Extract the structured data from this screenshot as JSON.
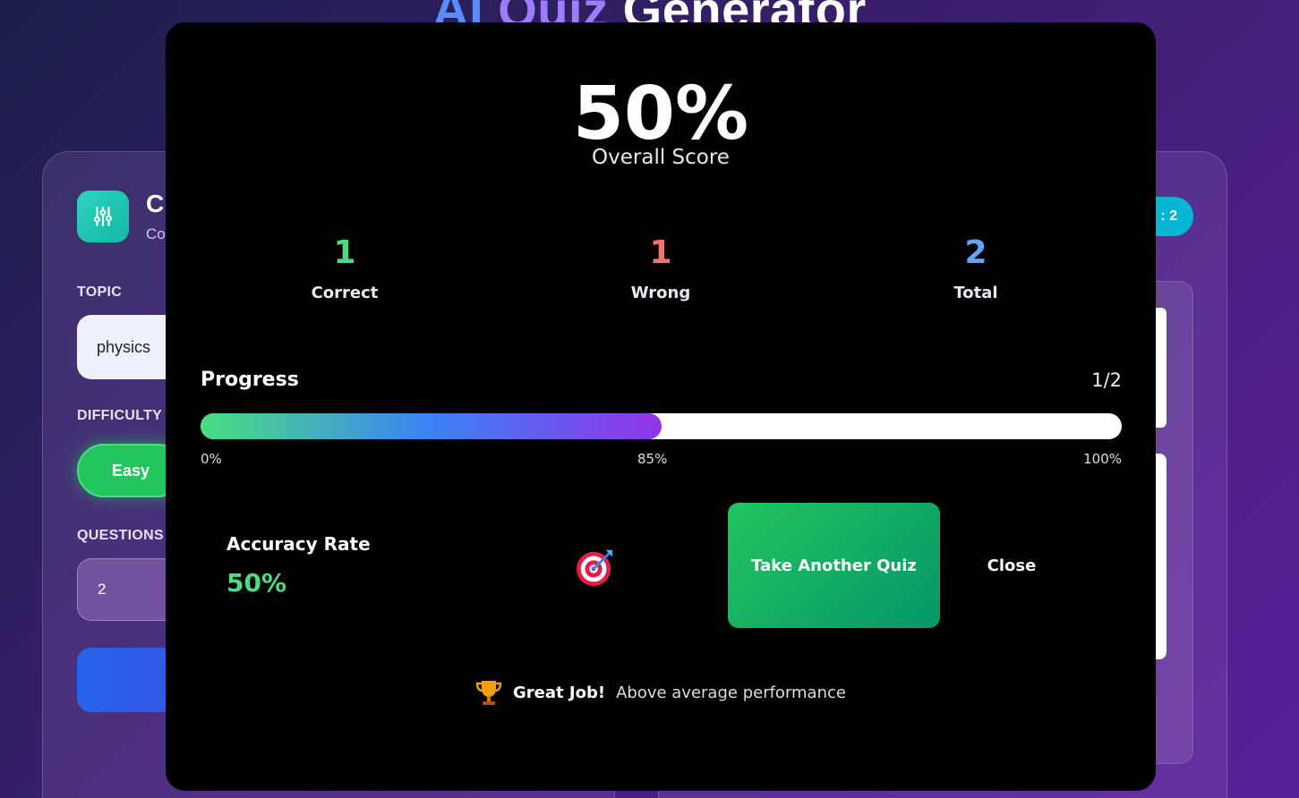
{
  "app": {
    "title_parts": [
      "AI",
      "Quiz",
      "Generator"
    ]
  },
  "config": {
    "title": "Cr",
    "subtitle": "Co",
    "topic_label": "TOPIC",
    "topic_value": "physics",
    "difficulty_label": "DIFFICULTY",
    "difficulty_selected": "Easy",
    "questions_label": "QUESTIONS",
    "questions_value": "2"
  },
  "quiz_panel": {
    "count_badge": ": 2"
  },
  "results": {
    "score": "50%",
    "score_label": "Overall Score",
    "stats": [
      {
        "value": "1",
        "label": "Correct"
      },
      {
        "value": "1",
        "label": "Wrong"
      },
      {
        "value": "2",
        "label": "Total"
      }
    ],
    "progress": {
      "title": "Progress",
      "count": "1/2",
      "fill_fraction": 0.5,
      "ticks": [
        "0%",
        "85%",
        "100%"
      ]
    },
    "accuracy_label": "Accuracy Rate",
    "accuracy_value": "50%",
    "take_another_label": "Take Another Quiz",
    "close_label": "Close",
    "footer_strong": "Great Job!",
    "footer_text": "Above average performance"
  },
  "colors": {
    "correct": "#4ade80",
    "wrong": "#f87171",
    "total": "#60a5fa",
    "accent_green": "#22c55e"
  },
  "icons": [
    "sliders-icon",
    "target-icon",
    "trophy-icon"
  ]
}
